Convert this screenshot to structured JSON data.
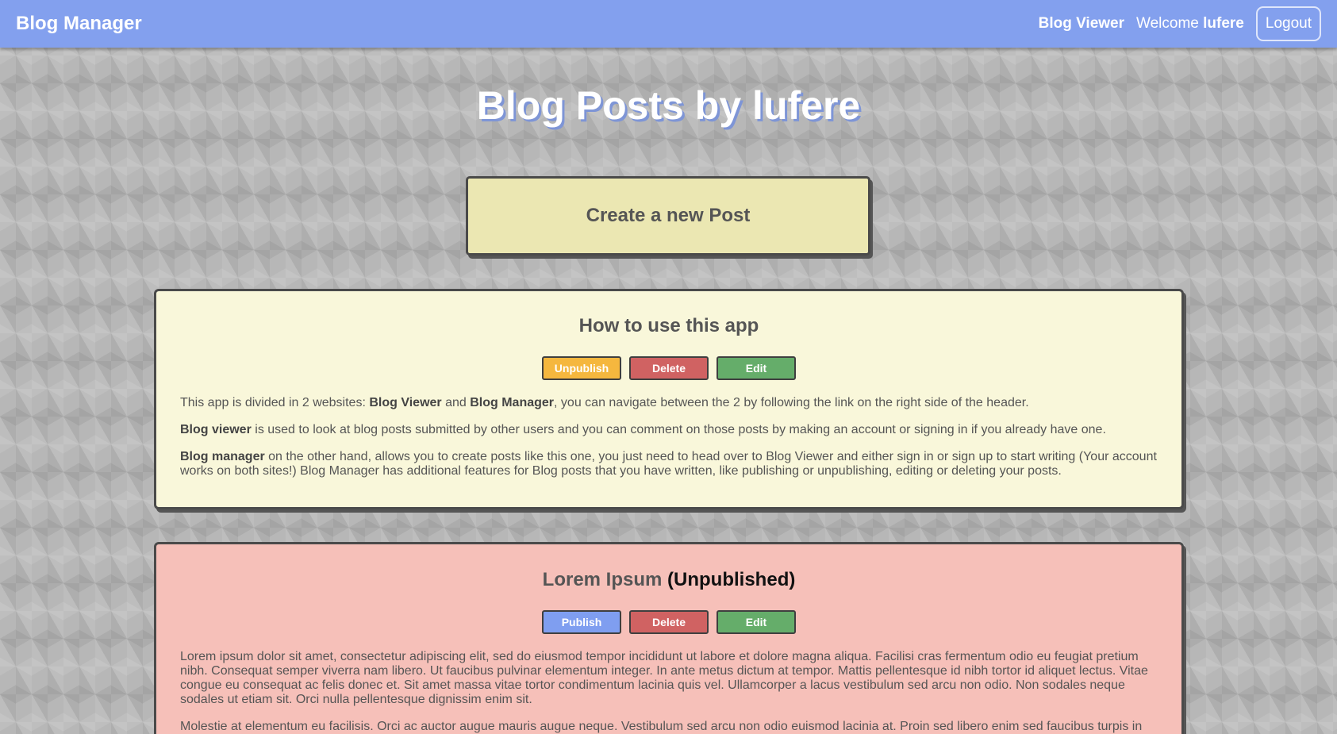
{
  "header": {
    "brand": "Blog Manager",
    "blog_viewer_link": "Blog Viewer",
    "welcome_prefix": "Welcome",
    "username": "lufere",
    "logout_label": "Logout"
  },
  "main": {
    "title": "Blog Posts by lufere",
    "create_button_label": "Create a new Post"
  },
  "posts": [
    {
      "title": "How to use this app",
      "status_label": "",
      "published": true,
      "background": "#f9f7da",
      "buttons": {
        "toggle_label": "Unpublish",
        "delete_label": "Delete",
        "edit_label": "Edit"
      },
      "paragraphs": [
        {
          "t1": "This app is divided in 2 websites: ",
          "b1": "Blog Viewer",
          "t2": " and ",
          "b2": "Blog Manager",
          "t3": ", you can navigate between the 2 by following the link on the right side of the header."
        },
        {
          "b1": "Blog viewer",
          "t1": " is used to look at blog posts submitted by other users and you can comment on those posts by making an account or signing in if you already have one."
        },
        {
          "b1": "Blog manager",
          "t1": " on the other hand, allows you to create posts like this one, you just need to head over to Blog Viewer and either sign in or sign up to start writing (Your account works on both sites!) Blog Manager has additional features for Blog posts that you have written, like publishing or unpublishing, editing or deleting your posts."
        }
      ]
    },
    {
      "title": "Lorem Ipsum",
      "status_label": "(Unpublished)",
      "published": false,
      "background": "#f6c0b9",
      "buttons": {
        "toggle_label": "Publish",
        "delete_label": "Delete",
        "edit_label": "Edit"
      },
      "paragraphs": [
        "Lorem ipsum dolor sit amet, consectetur adipiscing elit, sed do eiusmod tempor incididunt ut labore et dolore magna aliqua. Facilisi cras fermentum odio eu feugiat pretium nibh. Consequat semper viverra nam libero. Ut faucibus pulvinar elementum integer. In ante metus dictum at tempor. Mattis pellentesque id nibh tortor id aliquet lectus. Vitae congue eu consequat ac felis donec et. Sit amet massa vitae tortor condimentum lacinia quis vel. Ullamcorper a lacus vestibulum sed arcu non odio. Non sodales neque sodales ut etiam sit. Orci nulla pellentesque dignissim enim sit.",
        "Molestie at elementum eu facilisis. Orci ac auctor augue mauris augue neque. Vestibulum sed arcu non odio euismod lacinia at. Proin sed libero enim sed faucibus turpis in"
      ]
    }
  ],
  "colors": {
    "header": "#83a0ee",
    "unpublish": "#f5b73e",
    "publish": "#7f9ef0",
    "delete": "#d06262",
    "edit": "#65ad6a",
    "create_button": "#ebe7b2"
  }
}
